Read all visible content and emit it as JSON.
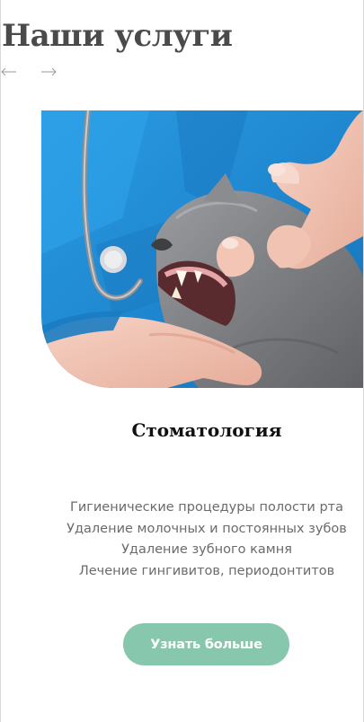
{
  "section": {
    "title": "Наши услуги"
  },
  "carousel": {
    "prev_icon": "arrow-left-icon",
    "next_icon": "arrow-right-icon"
  },
  "service": {
    "image_subject": "vet-examining-cat-teeth-photo",
    "name": "Стоматология",
    "features": [
      "Гигиенические процедуры полости рта",
      "Удаление молочных и постоянных зубов",
      "Удаление зубного камня",
      "Лечение гингивитов, периодонтитов"
    ],
    "cta_label": "Узнать больше"
  },
  "colors": {
    "title": "#4a4a4a",
    "button": "#86c7ad",
    "button_text": "#ffffff",
    "feature_text": "#6b6b6b",
    "scrub_blue": "#1f8bd6"
  }
}
